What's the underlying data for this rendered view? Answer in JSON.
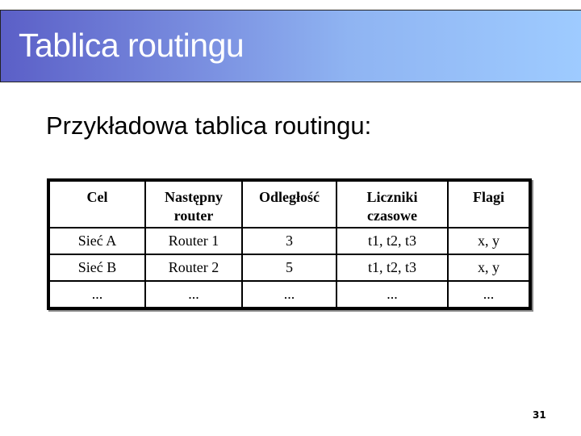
{
  "slide": {
    "title": "Tablica routingu",
    "subtitle": "Przykładowa tablica routingu:",
    "page_number": "31",
    "colors": {
      "title_gradient_start": "#5b5fc7",
      "title_gradient_end": "#9ecbff",
      "title_text": "#ffffff"
    }
  },
  "table": {
    "headers": [
      [
        "Cel"
      ],
      [
        "Następny",
        "router"
      ],
      [
        "Odległość"
      ],
      [
        "Liczniki",
        "czasowe"
      ],
      [
        "Flagi"
      ]
    ],
    "rows": [
      [
        "Sieć A",
        "Router 1",
        "3",
        "t1, t2, t3",
        "x, y"
      ],
      [
        "Sieć B",
        "Router 2",
        "5",
        "t1, t2, t3",
        "x, y"
      ],
      [
        "...",
        "...",
        "...",
        "...",
        "..."
      ]
    ]
  }
}
